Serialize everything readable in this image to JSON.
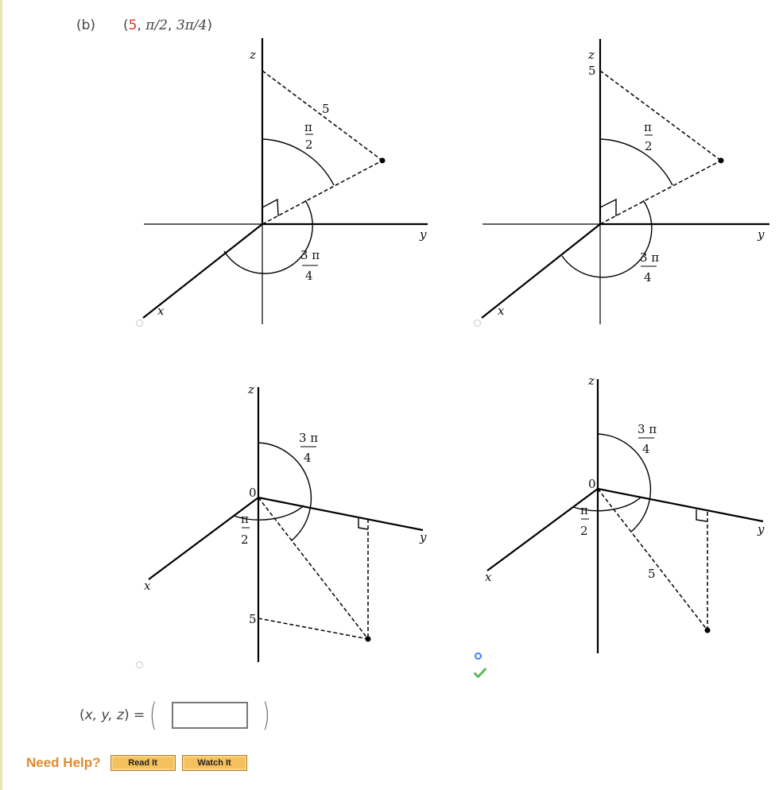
{
  "question": {
    "part_label": "(b)",
    "coords": {
      "open": "(",
      "rho": "5",
      "sep1": ", ",
      "phi": "π/2",
      "sep2": ", ",
      "theta": "3π/4",
      "close": ")"
    }
  },
  "options": [
    {
      "id": "option-1",
      "selected": false,
      "labels": {
        "z": "z",
        "y": "y",
        "x": "x",
        "rho": "5",
        "phi_num": "π",
        "phi_den": "2",
        "theta_num": "3 π",
        "theta_den": "4"
      }
    },
    {
      "id": "option-2",
      "selected": false,
      "labels": {
        "z": "z",
        "z_tick": "5",
        "y": "y",
        "x": "x",
        "phi_num": "π",
        "phi_den": "2",
        "theta_num": "3 π",
        "theta_den": "4"
      }
    },
    {
      "id": "option-3",
      "selected": false,
      "labels": {
        "z": "z",
        "origin": "0",
        "y": "y",
        "x": "x",
        "z_tick": "5",
        "phi_num": "π",
        "phi_den": "2",
        "theta_num": "3 π",
        "theta_den": "4"
      }
    },
    {
      "id": "option-4",
      "selected": true,
      "correct": true,
      "labels": {
        "z": "z",
        "origin": "0",
        "y": "y",
        "x": "x",
        "rho": "5",
        "phi_num": "π",
        "phi_den": "2",
        "theta_num": "3 π",
        "theta_den": "4"
      }
    }
  ],
  "answer": {
    "label_open": "(",
    "label_vars": "x, y, z",
    "label_close": ") =",
    "paren_open": "(",
    "paren_close": ")",
    "value": "",
    "placeholder": ""
  },
  "help": {
    "label": "Need Help?",
    "read_it": "Read It",
    "watch_it": "Watch It"
  },
  "colors": {
    "rho_highlight": "#e0301e",
    "help_orange": "#e08a2e",
    "selected_radio": "#3b82f6",
    "correct_check": "#5cb85c"
  }
}
